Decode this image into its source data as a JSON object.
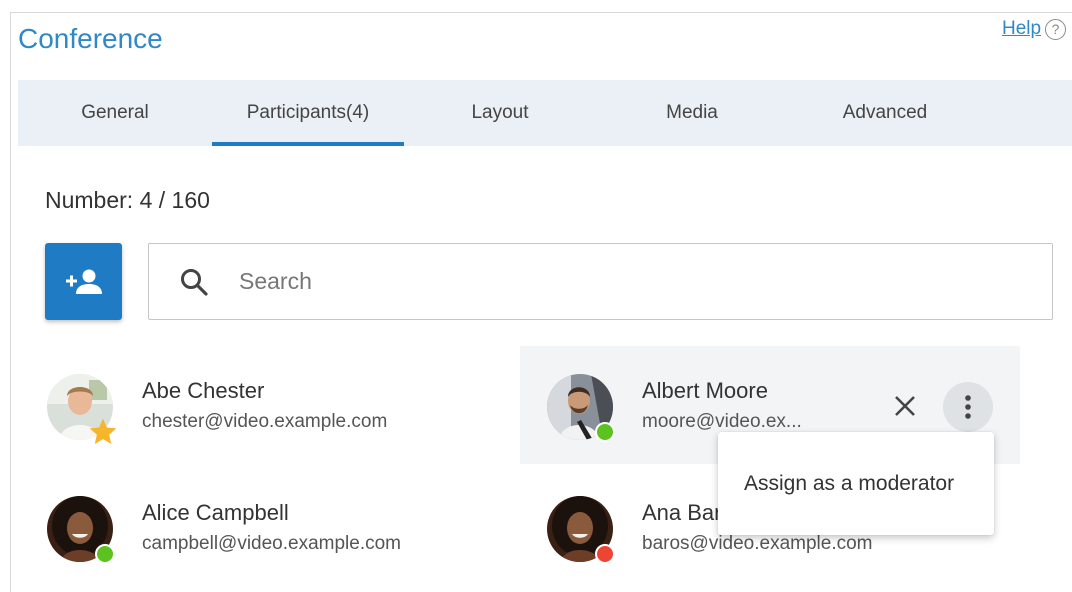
{
  "header": {
    "title": "Conference",
    "help_label": "Help",
    "help_icon_glyph": "?"
  },
  "tabs": [
    {
      "label": "General",
      "active": false
    },
    {
      "label": "Participants(4)",
      "active": true
    },
    {
      "label": "Layout",
      "active": false
    },
    {
      "label": "Media",
      "active": false
    },
    {
      "label": "Advanced",
      "active": false
    }
  ],
  "participants_view": {
    "count_label": "Number: 4 / 160",
    "add_button_icon": "person-add-icon",
    "search": {
      "placeholder": "Search",
      "value": "",
      "icon": "search-icon"
    }
  },
  "participants": [
    {
      "name": "Abe Chester",
      "email": "chester@video.example.com",
      "badge": "star",
      "badge_color": "#f7b52b"
    },
    {
      "name": "Albert Moore",
      "email": "moore@video.ex...",
      "badge": "online",
      "badge_color": "#5cc21f"
    },
    {
      "name": "Alice Campbell",
      "email": "campbell@video.example.com",
      "badge": "online",
      "badge_color": "#5cc21f"
    },
    {
      "name": "Ana Bar",
      "email": "baros@video.example.com",
      "badge": "busy",
      "badge_color": "#ee4433"
    }
  ],
  "context_menu": {
    "items": [
      {
        "label": "Assign as a moderator"
      }
    ]
  },
  "colors": {
    "accent": "#1f7cc4",
    "title": "#2f88c7",
    "tab_bar_bg": "#eaf0f5"
  }
}
